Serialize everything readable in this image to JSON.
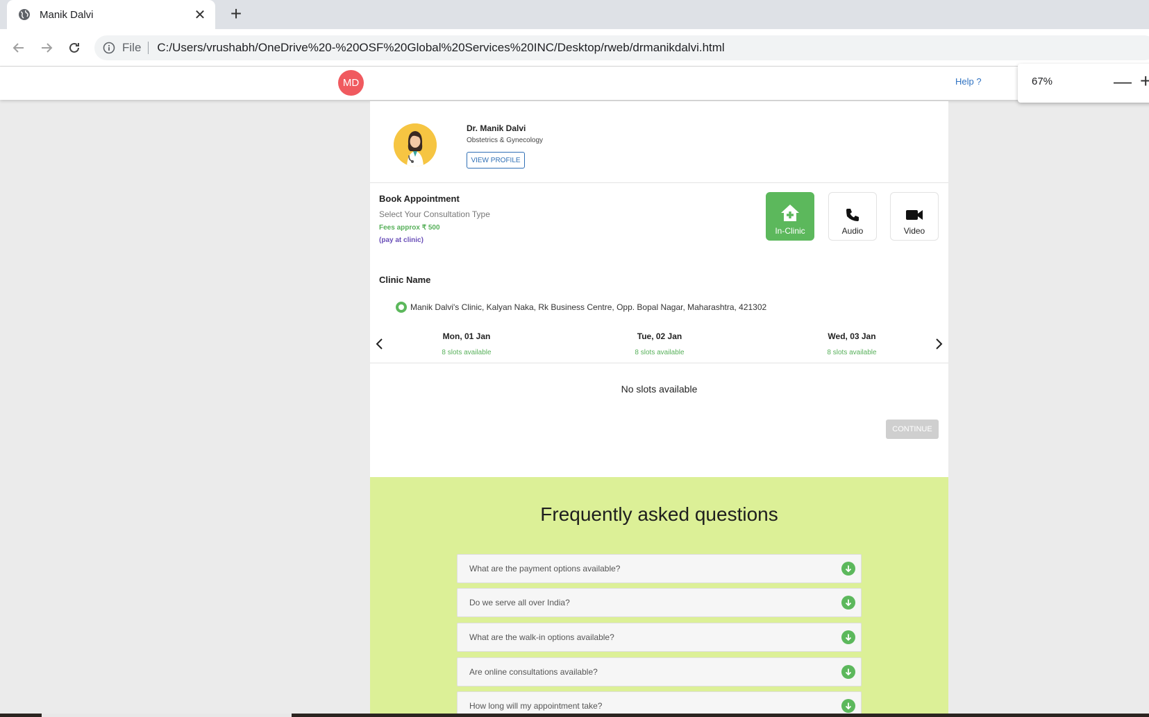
{
  "browser": {
    "tab_title": "Manik Dalvi",
    "tab_close": "✕",
    "new_tab": "+",
    "url_scheme": "File",
    "url": "C:/Users/vrushabh/OneDrive%20-%20OSF%20Global%20Services%20INC/Desktop/rweb/drmanikdalvi.html",
    "zoom_value": "67%",
    "zoom_minus": "—",
    "zoom_plus": "+"
  },
  "header": {
    "logo_text": "MD",
    "help_label": "Help ?"
  },
  "doctor": {
    "name": "Dr. Manik Dalvi",
    "specialty": "Obstetrics & Gynecology",
    "view_profile_label": "VIEW PROFILE"
  },
  "booking": {
    "title": "Book Appointment",
    "subtitle": "Select Your Consultation Type",
    "fees": "Fees approx ₹ 500",
    "pay_note": "(pay at clinic)",
    "types": [
      {
        "label": "In-Clinic",
        "icon": "clinic-icon",
        "active": true
      },
      {
        "label": "Audio",
        "icon": "phone-icon",
        "active": false
      },
      {
        "label": "Video",
        "icon": "video-camera-icon",
        "active": false
      }
    ]
  },
  "clinic": {
    "title": "Clinic Name",
    "address": "Manik Dalvi's Clinic, Kalyan Naka, Rk Business Centre, Opp. Bopal Nagar, Maharashtra, 421302"
  },
  "dates": [
    {
      "label": "Mon, 01 Jan",
      "slots": "8 slots available"
    },
    {
      "label": "Tue, 02 Jan",
      "slots": "8 slots available"
    },
    {
      "label": "Wed, 03 Jan",
      "slots": "8 slots available"
    }
  ],
  "slots_message": "No slots available",
  "continue_label": "CONTINUE",
  "faq": {
    "title": "Frequently asked questions",
    "items": [
      "What are the payment options available?",
      "Do we serve all over India?",
      "What are the walk-in options available?",
      "Are online consultations available?",
      "How long will my appointment take?"
    ]
  },
  "colors": {
    "accent_green": "#5cb85c",
    "logo_red": "#f05a5f",
    "faq_bg": "#dcf097",
    "link_blue": "#2f72c2"
  }
}
